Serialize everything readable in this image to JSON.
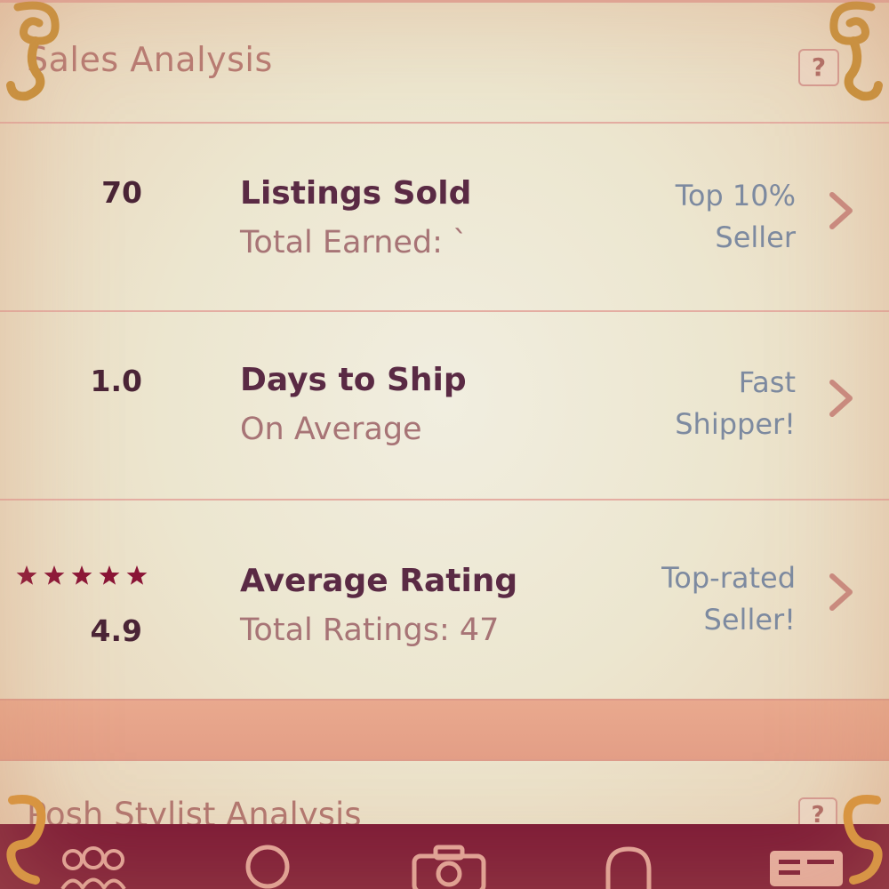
{
  "sales_analysis": {
    "title": "Sales Analysis",
    "help": "?"
  },
  "rows": [
    {
      "value": "70",
      "title": "Listings Sold",
      "subtitle": "Total Earned: `",
      "badge_line1": "Top 10%",
      "badge_line2": "Seller"
    },
    {
      "value": "1.0",
      "title": "Days to Ship",
      "subtitle": "On Average",
      "badge_line1": "Fast",
      "badge_line2": "Shipper!"
    },
    {
      "value": "4.9",
      "stars": 5,
      "title": "Average Rating",
      "subtitle": "Total Ratings: 47",
      "badge_line1": "Top-rated",
      "badge_line2": "Seller!"
    }
  ],
  "posh_stylist": {
    "title": "Posh Stylist Analysis",
    "help": "?"
  },
  "tabbar": {
    "icons": [
      "people-icon",
      "search-icon",
      "camera-icon",
      "bell-icon",
      "menu-icon"
    ]
  },
  "colors": {
    "accent": "#7d1a36",
    "star": "#8a1436",
    "badge": "#7d8aa0",
    "ornament": "#c8903a"
  }
}
